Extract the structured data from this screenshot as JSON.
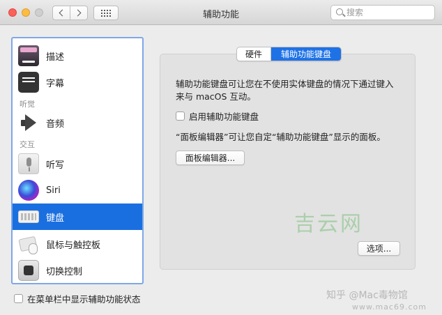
{
  "window": {
    "title": "辅助功能"
  },
  "toolbar": {
    "search_placeholder": "搜索",
    "icons": {
      "back": "chevron-left-icon",
      "forward": "chevron-right-icon",
      "grid": "grid-icon"
    }
  },
  "sidebar": {
    "items": [
      {
        "label": "描述",
        "icon": "description-icon"
      },
      {
        "label": "字幕",
        "icon": "captions-icon"
      },
      {
        "label": "音频",
        "icon": "speaker-icon"
      },
      {
        "label": "听写",
        "icon": "microphone-icon"
      },
      {
        "label": "Siri",
        "icon": "siri-icon"
      },
      {
        "label": "键盘",
        "icon": "keyboard-icon",
        "selected": true
      },
      {
        "label": "鼠标与触控板",
        "icon": "mouse-trackpad-icon"
      },
      {
        "label": "切换控制",
        "icon": "switch-control-icon"
      }
    ],
    "headers": {
      "hearing": "听觉",
      "interaction": "交互"
    }
  },
  "tabs": [
    {
      "label": "硬件",
      "selected": false
    },
    {
      "label": "辅助功能键盘",
      "selected": true
    }
  ],
  "panel": {
    "description_line1": "辅助功能键盘可让您在不使用实体键盘的情况下通过键入",
    "description_line2": "来与 macOS 互动。",
    "enable_checkbox_label": "启用辅助功能键盘",
    "enable_checked": false,
    "editor_text": "“面板编辑器”可让您自定“辅助功能键盘”显示的面板。",
    "editor_button": "面板编辑器...",
    "options_button": "选项..."
  },
  "footer": {
    "menubar_checkbox_label": "在菜单栏中显示辅助功能状态",
    "menubar_checked": false
  },
  "watermarks": {
    "mark": "吉云网",
    "site": "知乎 @Mac毒物馆",
    "url": "www.mac69.com"
  },
  "colors": {
    "accent": "#1a6fe0",
    "selection": "#1a6fe0"
  }
}
